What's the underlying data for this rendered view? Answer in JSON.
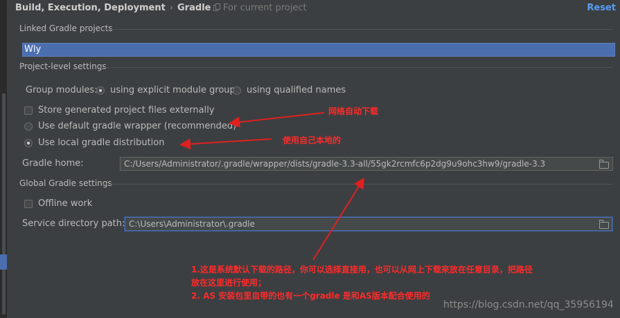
{
  "header": {
    "breadcrumb_parent": "Build, Execution, Deployment",
    "breadcrumb_separator": "›",
    "breadcrumb_current": "Gradle",
    "scope_label": "For current project",
    "reset_label": "Reset"
  },
  "linked_projects": {
    "section_title": "Linked Gradle projects",
    "selected_project": "Wly"
  },
  "project_settings": {
    "section_title": "Project-level settings",
    "group_modules_label": "Group modules:",
    "group_options": [
      {
        "label": "using explicit module groups",
        "selected": true
      },
      {
        "label": "using qualified names",
        "selected": false
      }
    ],
    "store_externally_label": "Store generated project files externally",
    "store_externally_checked": false,
    "distribution_options": [
      {
        "label": "Use default gradle wrapper (recommended)",
        "selected": false
      },
      {
        "label": "Use local gradle distribution",
        "selected": true
      }
    ],
    "gradle_home_label": "Gradle home:",
    "gradle_home_value": "C:/Users/Administrator/.gradle/wrapper/dists/gradle-3.3-all/55gk2rcmfc6p2dg9u9ohc3hw9/gradle-3.3"
  },
  "global_settings": {
    "section_title": "Global Gradle settings",
    "offline_label": "Offline work",
    "offline_checked": false,
    "service_dir_label": "Service directory path:",
    "service_dir_value": "C:\\Users\\Administrator\\.gradle"
  },
  "annotations": {
    "network_download": "网络自动下载",
    "use_local": "使用自己本地的",
    "note_line1": "1.这是系统默认下载的路径，你可以选择直接用，也可以从网上下载来放在任意目录，把路径",
    "note_line2": "放在这里进行使用；",
    "note_line3": "2. AS 安装包里自带的也有一个gradle 是和AS版本配合使用的",
    "arrow_color": "#e02020"
  },
  "watermark": "https://blog.csdn.net/qq_35956194",
  "icons": {
    "scope": "copy-icon",
    "browse": "folder-icon"
  }
}
